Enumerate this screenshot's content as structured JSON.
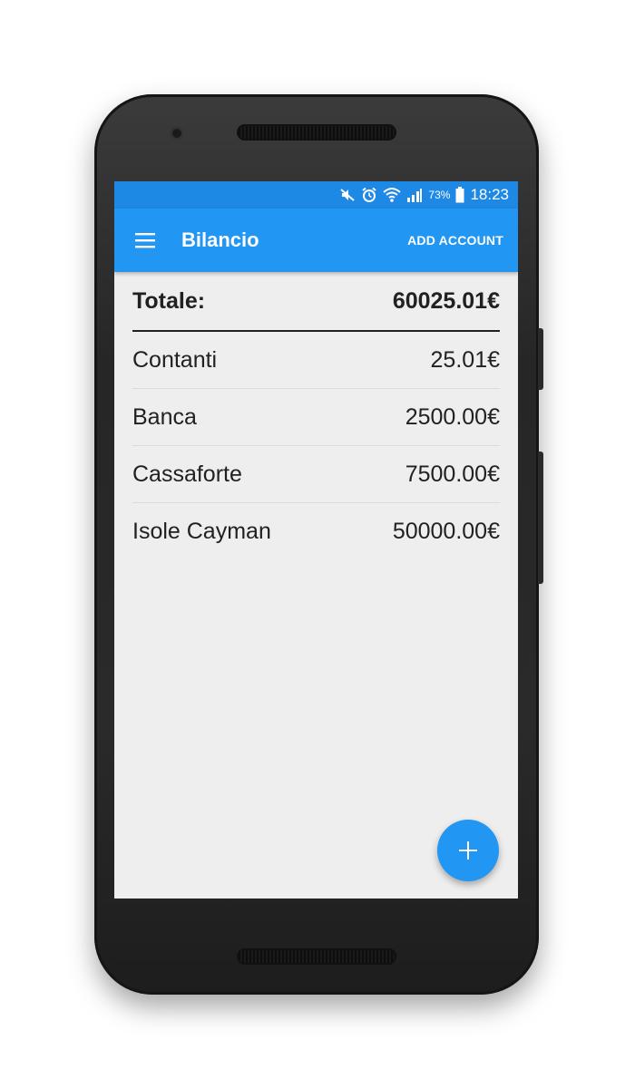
{
  "status_bar": {
    "battery_percent": "73%",
    "time": "18:23",
    "icons": [
      "mute-icon",
      "alarm-icon",
      "wifi-icon",
      "signal-icon",
      "battery-icon"
    ]
  },
  "app_bar": {
    "title": "Bilancio",
    "action_label": "ADD ACCOUNT",
    "menu_icon": "menu-icon"
  },
  "total": {
    "label": "Totale:",
    "value": "60025.01€"
  },
  "accounts": [
    {
      "name": "Contanti",
      "balance": "25.01€"
    },
    {
      "name": "Banca",
      "balance": "2500.00€"
    },
    {
      "name": "Cassaforte",
      "balance": "7500.00€"
    },
    {
      "name": "Isole Cayman",
      "balance": "50000.00€"
    }
  ],
  "fab": {
    "icon": "plus-icon"
  },
  "colors": {
    "primary": "#2196f3",
    "primary_dark": "#1e88e5",
    "background": "#eeeeee",
    "text": "#212121"
  }
}
